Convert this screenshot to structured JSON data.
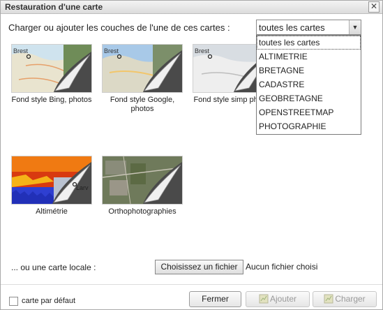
{
  "dialog": {
    "title": "Restauration d'une carte",
    "close_glyph": "✕"
  },
  "prompt": "Charger ou ajouter les couches de l'une de ces cartes :",
  "select": {
    "value": "toutes les cartes",
    "options": [
      "toutes les cartes",
      "ALTIMETRIE",
      "BRETAGNE",
      "CADASTRE",
      "GEOBRETAGNE",
      "OPENSTREETMAP",
      "PHOTOGRAPHIE"
    ]
  },
  "maps": [
    {
      "label": "Fond style Bing, photos",
      "city": "Brest",
      "style": "bing"
    },
    {
      "label": "Fond style Google, photos",
      "city": "Brest",
      "style": "google"
    },
    {
      "label": "Fond style simp photos",
      "city": "Brest",
      "style": "simple"
    },
    {
      "label": "Altimétrie",
      "city": "Larv",
      "style": "alti"
    },
    {
      "label": "Orthophotographies",
      "city": "",
      "style": "ortho"
    }
  ],
  "local": {
    "label": "... ou une carte locale :",
    "file_button": "Choisissez un fichier",
    "file_status": "Aucun fichier choisi"
  },
  "footer": {
    "default_checkbox_label": "carte par défaut",
    "close_button": "Fermer",
    "add_button": "Ajouter",
    "load_button": "Charger"
  }
}
